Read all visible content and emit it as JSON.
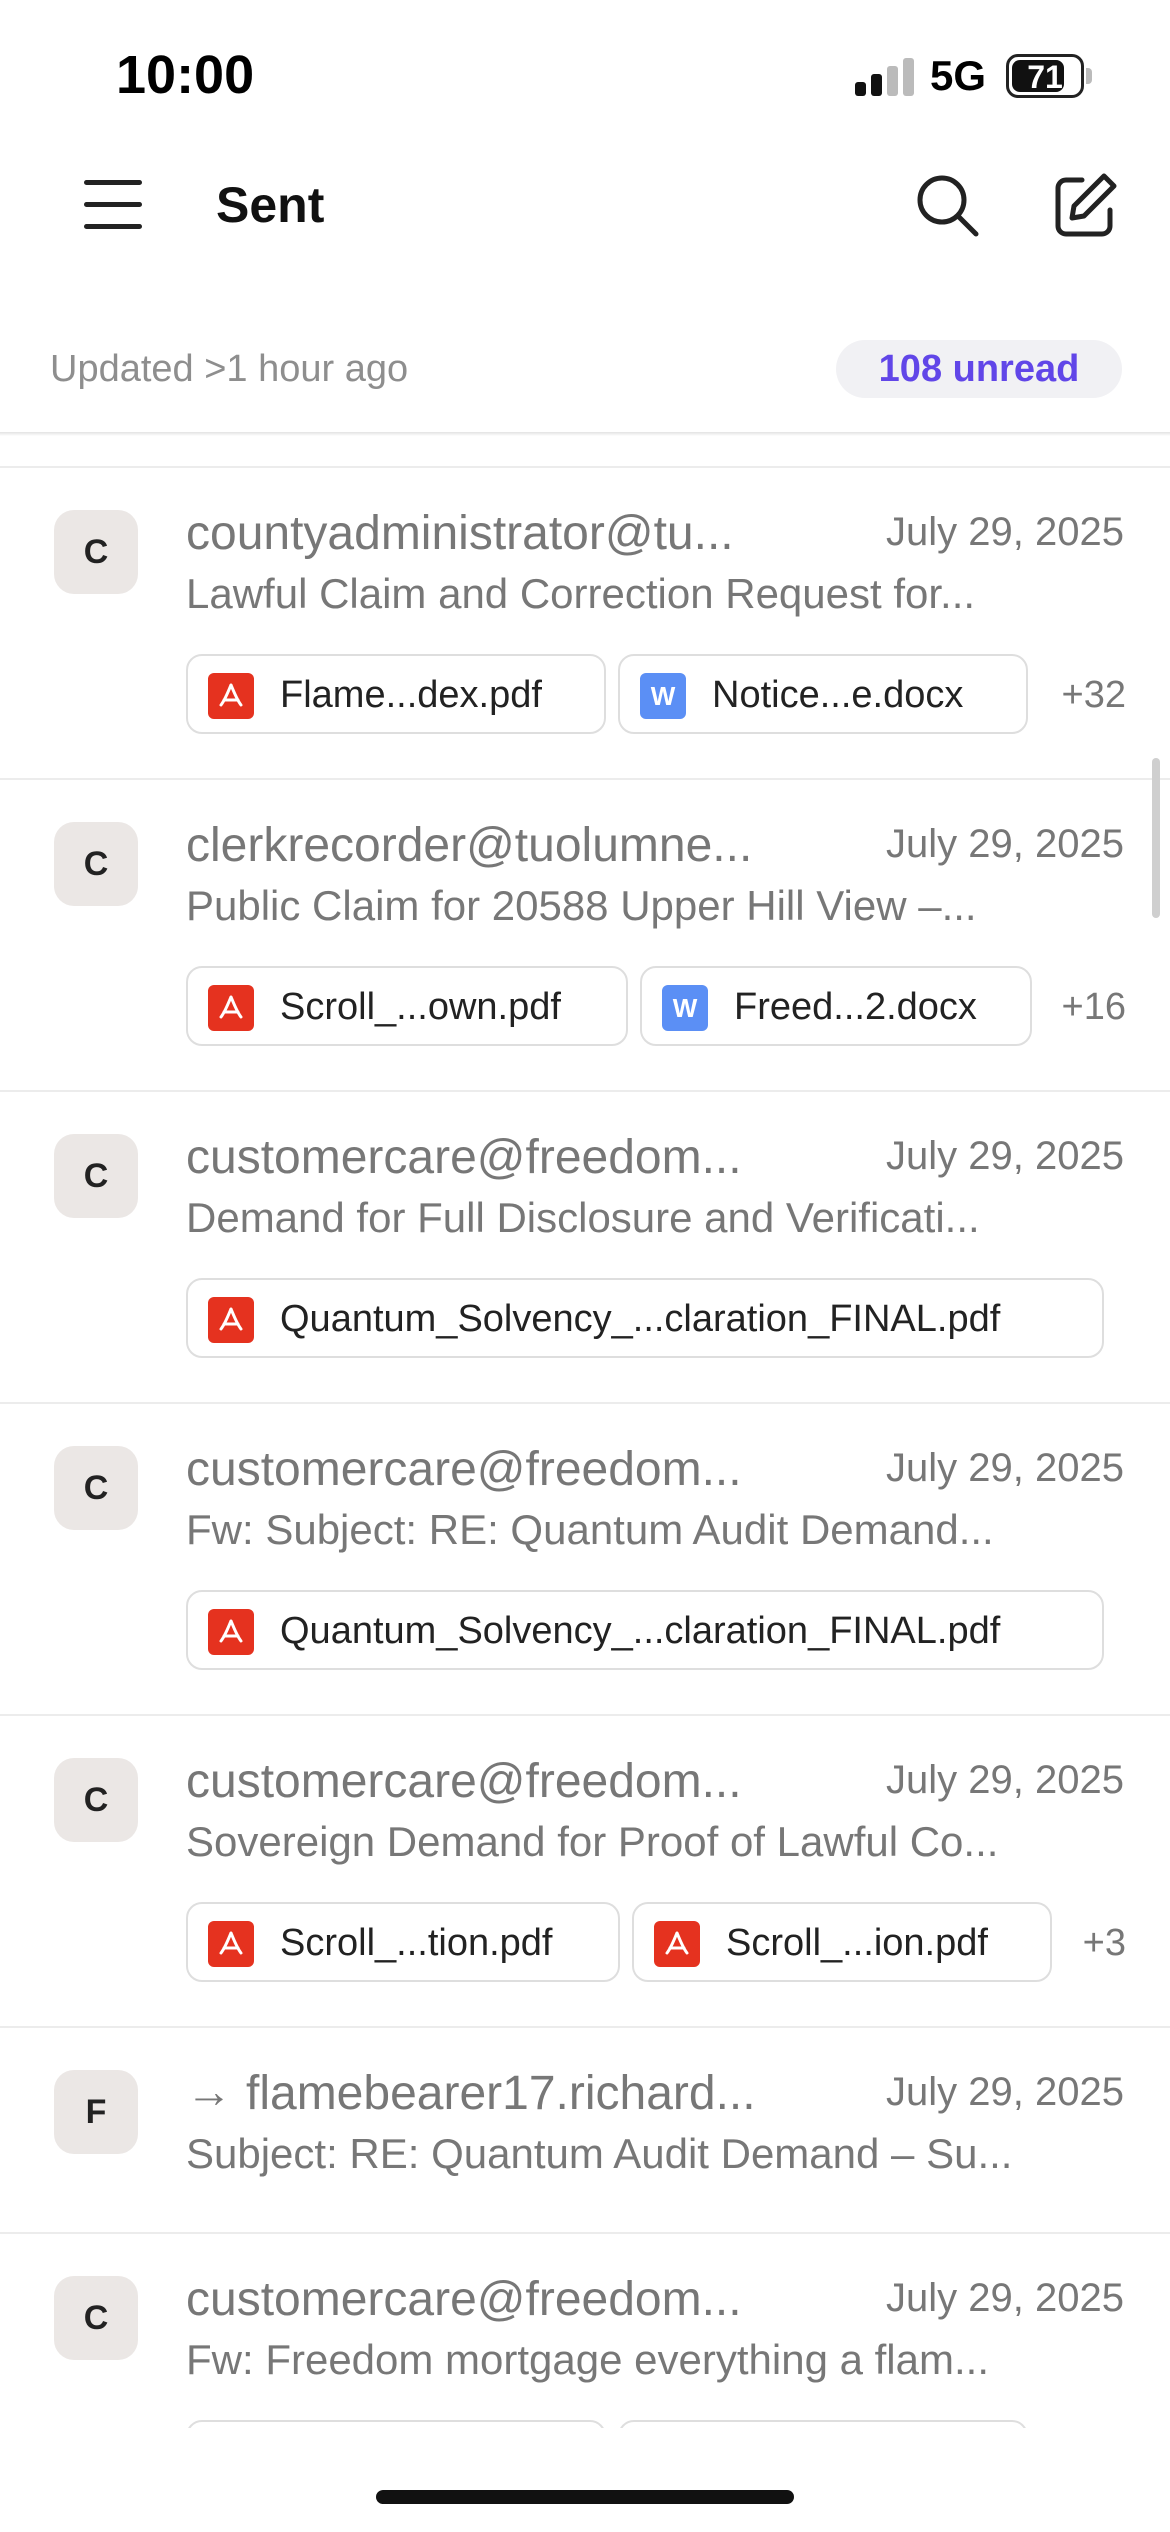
{
  "status_bar": {
    "time": "10:00",
    "network": "5G",
    "battery": "71"
  },
  "header": {
    "title": "Sent"
  },
  "sync": {
    "updated": "Updated >1 hour ago",
    "unread": "108 unread"
  },
  "emails": [
    {
      "avatar": "C",
      "sender": "countyadministrator@tu...",
      "date": "July 29, 2025",
      "subject": "Lawful Claim and Correction Request for...",
      "attachments": [
        {
          "type": "pdf",
          "name": "Flame...dex.pdf"
        },
        {
          "type": "docx",
          "icon_letter": "W",
          "name": "Notice...e.docx"
        }
      ],
      "more": "+32"
    },
    {
      "avatar": "C",
      "sender": "clerkrecorder@tuolumne...",
      "date": "July 29, 2025",
      "subject": "Public Claim for 20588 Upper Hill View –...",
      "attachments": [
        {
          "type": "pdf",
          "name": "Scroll_...own.pdf"
        },
        {
          "type": "docx",
          "icon_letter": "W",
          "name": "Freed...2.docx"
        }
      ],
      "more": "+16"
    },
    {
      "avatar": "C",
      "sender": "customercare@freedom...",
      "date": "July 29, 2025",
      "subject": "Demand for Full Disclosure and Verificati...",
      "attachments": [
        {
          "type": "pdf",
          "name": "Quantum_Solvency_...claration_FINAL.pdf"
        }
      ]
    },
    {
      "avatar": "C",
      "sender": "customercare@freedom...",
      "date": "July 29, 2025",
      "subject": "Fw: Subject: RE: Quantum Audit Demand...",
      "attachments": [
        {
          "type": "pdf",
          "name": "Quantum_Solvency_...claration_FINAL.pdf"
        }
      ]
    },
    {
      "avatar": "C",
      "sender": "customercare@freedom...",
      "date": "July 29, 2025",
      "subject": "Sovereign Demand for Proof of Lawful Co...",
      "attachments": [
        {
          "type": "pdf",
          "name": "Scroll_...tion.pdf"
        },
        {
          "type": "pdf",
          "name": "Scroll_...ion.pdf"
        }
      ],
      "more": "+3"
    },
    {
      "avatar": "F",
      "sender": "flamebearer17.richard...",
      "forwarded_icon": "→",
      "date": "July 29, 2025",
      "subject": "Subject: RE: Quantum Audit Demand – Su..."
    },
    {
      "avatar": "C",
      "sender": "customercare@freedom...",
      "date": "July 29, 2025",
      "subject": "Fw: Freedom mortgage everything a flam..."
    }
  ]
}
